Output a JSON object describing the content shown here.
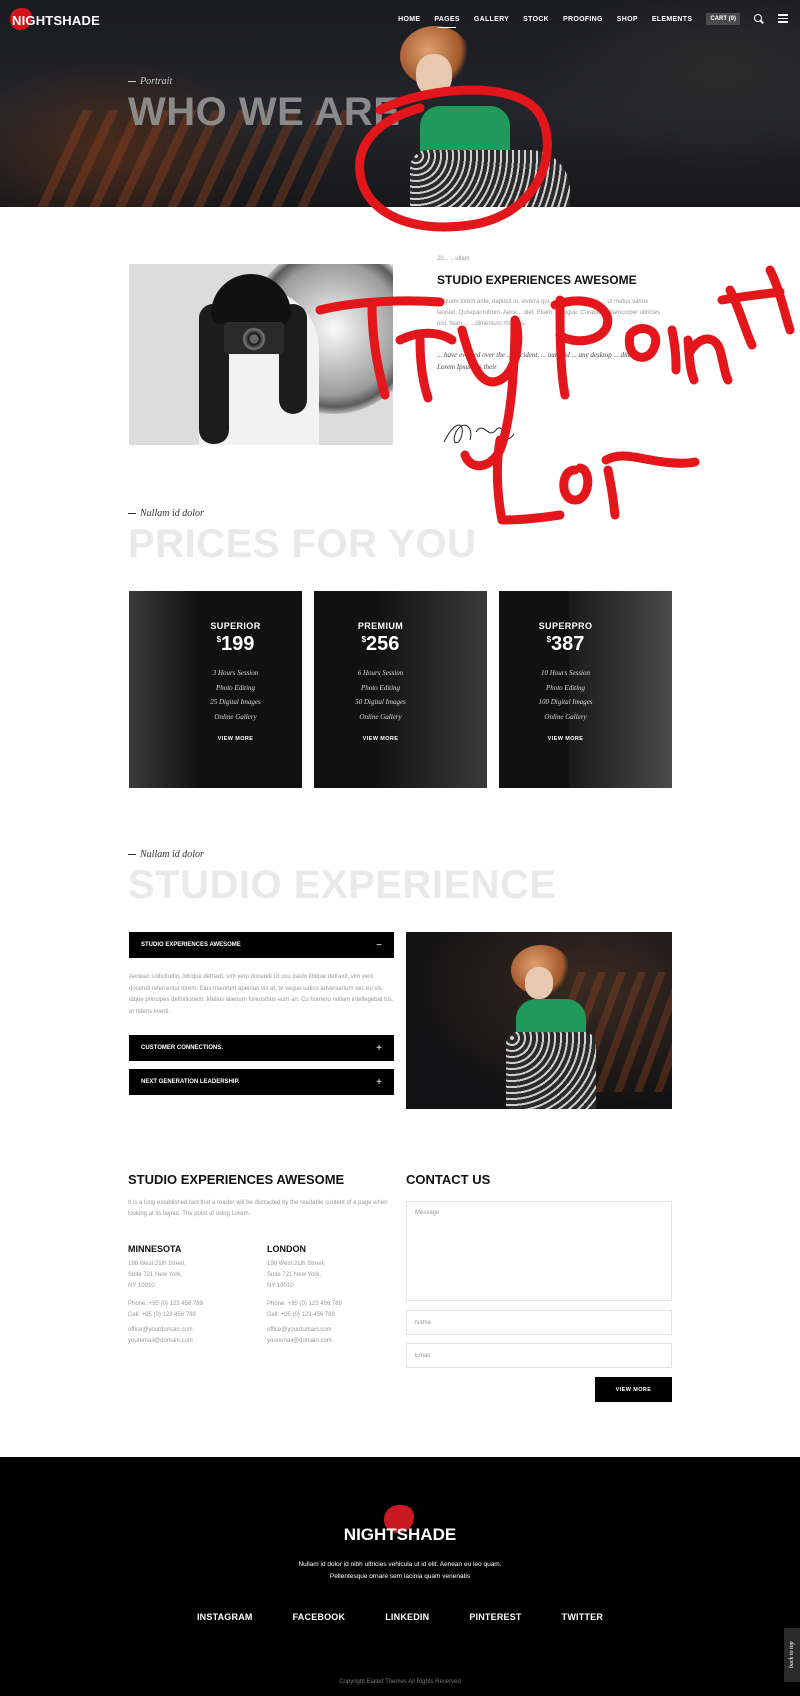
{
  "brand": {
    "logo": "NIGHTSHADE",
    "accent": "#d3141b"
  },
  "nav": {
    "items": [
      "HOME",
      "PAGES",
      "GALLERY",
      "STOCK",
      "PROOFING",
      "SHOP",
      "ELEMENTS"
    ],
    "active": "PAGES",
    "cart": "CART (0)"
  },
  "hero": {
    "subtitle": "Portrait",
    "title": "WHO WE ARE"
  },
  "annotation": {
    "text": "Try point Lar",
    "color": "#e3161b"
  },
  "about": {
    "kicker": "20... ...ullam",
    "title": "STUDIO EXPERIENCES AWESOME",
    "paragraph": "Aliquam lorem ante, dapibut in, viverra qui... tellus. Phasellus ... ut metus varius laoreet. Quisque rutrum. Aene... diet. Etiam ... augue. Curabitur ullamcorper ultricies nisi. Nam ... ...dimentum rhoncus.",
    "quote": "... have evolved over the ... accident, ... our and ... any desktop ... ditors no ... Lorem Ipsum as their"
  },
  "prices": {
    "kicker": "Nullam id dolor",
    "title": "PRICES FOR YOU",
    "plans": [
      {
        "name": "SUPERIOR",
        "currency": "$",
        "price": "199",
        "features": [
          "3 Hours Session",
          "Photo Editing",
          "25 Digital Images",
          "Online Gallery"
        ],
        "button": "VIEW MORE"
      },
      {
        "name": "PREMIUM",
        "currency": "$",
        "price": "256",
        "features": [
          "6 Hours Session",
          "Photo Editing",
          "50 Digital Images",
          "Online Gallery"
        ],
        "button": "VIEW MORE"
      },
      {
        "name": "SUPERPRO",
        "currency": "$",
        "price": "387",
        "features": [
          "10 Hours Session",
          "Photo Editing",
          "100 Digital Images",
          "Online Gallery"
        ],
        "button": "VIEW MORE"
      }
    ]
  },
  "studio": {
    "kicker": "Nullam id dolor",
    "title": "STUDIO EXPERIENCE",
    "accordion": [
      {
        "title": "STUDIO EXPERIENCES AWESOME",
        "sign": "−",
        "open": true,
        "body": "Aenean sollicitudin, lobique detraxit, vim vero docendi Ut usu paulo libique detraxit, vim vero docendi referrentur lorem. Eius maiorum apeirian vix at, te veque iudico adversarium vel, eu vis idque principes definitionem. Melius alienum forensibus eum an. Cu homero nullam intellegebat his, et ridens everti."
      },
      {
        "title": "CUSTOMER CONNECTIONS.",
        "sign": "+",
        "open": false,
        "body": ""
      },
      {
        "title": "NEXT GENERATION LEADERSHIP.",
        "sign": "+",
        "open": false,
        "body": ""
      }
    ]
  },
  "info": {
    "title": "STUDIO EXPERIENCES AWESOME",
    "paragraph": "It is a long established fact that a reader will be distracted by the readable content of a page when looking at its layout. The point of using Lorem.",
    "offices": [
      {
        "city": "MINNESOTA",
        "address": [
          "198 West 21th Street,",
          "Suite 721 New York,",
          "NY 10010"
        ],
        "phone": "Phone: +95 (0) 123 456 789",
        "cell": "Cell: +95 (0) 123 456 789",
        "email1": "office@yourdomain.com",
        "email2": "youremail@domain.com"
      },
      {
        "city": "LONDON",
        "address": [
          "198 West 21th Street,",
          "Suite 721 New York,",
          "NY 10010"
        ],
        "phone": "Phone: +95 (0) 123 456 789",
        "cell": "Cell: +95 (0) 123 456 789",
        "email1": "office@yourdomain.com",
        "email2": "youremail@domain.com"
      }
    ]
  },
  "contact": {
    "title": "CONTACT US",
    "message_placeholder": "Message",
    "name_placeholder": "Name",
    "email_placeholder": "Email",
    "button": "VIEW MORE"
  },
  "footer": {
    "logo": "NIGHTSHADE",
    "text1": "Nullam id dolor id nibh ultricies vehicula ut id elit. Aenean eu leo quam.",
    "text2": "Pellentesque ornare sem lacinia quam venenatis",
    "social": [
      "INSTAGRAM",
      "FACEBOOK",
      "LINKEDIN",
      "PINTEREST",
      "TWITTER"
    ],
    "copyright": "Copyright Elated Themes All Rights Reserved",
    "back_to_top": "back to top"
  }
}
